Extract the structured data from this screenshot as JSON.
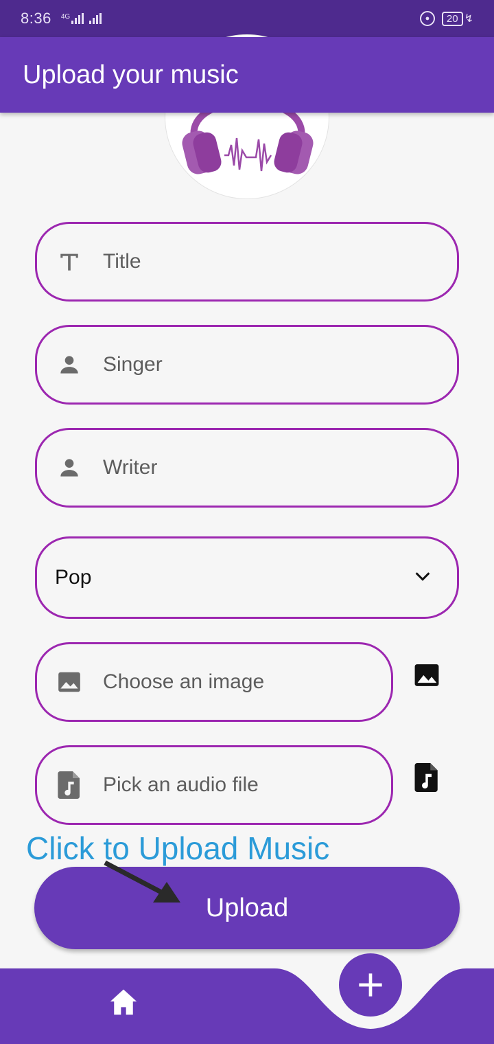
{
  "status_bar": {
    "time": "8:36",
    "network": "4G",
    "battery": "20"
  },
  "app_bar": {
    "title": "Upload your music"
  },
  "form": {
    "title_placeholder": "Title",
    "singer_placeholder": "Singer",
    "writer_placeholder": "Writer",
    "genre_value": "Pop",
    "image_placeholder": "Choose an image",
    "audio_placeholder": "Pick an audio file"
  },
  "annotation": {
    "text": "Click to Upload Music"
  },
  "upload_button": {
    "label": "Upload"
  },
  "colors": {
    "primary": "#673ab7",
    "status_bar": "#4e2a8e",
    "field_border": "#9c27b0",
    "annotation": "#2b9bd8"
  },
  "icons": {
    "title_field": "text-fields-icon",
    "singer_field": "person-icon",
    "writer_field": "person-icon",
    "genre_dropdown": "chevron-down-icon",
    "image_field": "image-icon",
    "audio_field": "audio-file-icon",
    "bottom_home": "home-icon",
    "bottom_fab": "plus-icon"
  }
}
